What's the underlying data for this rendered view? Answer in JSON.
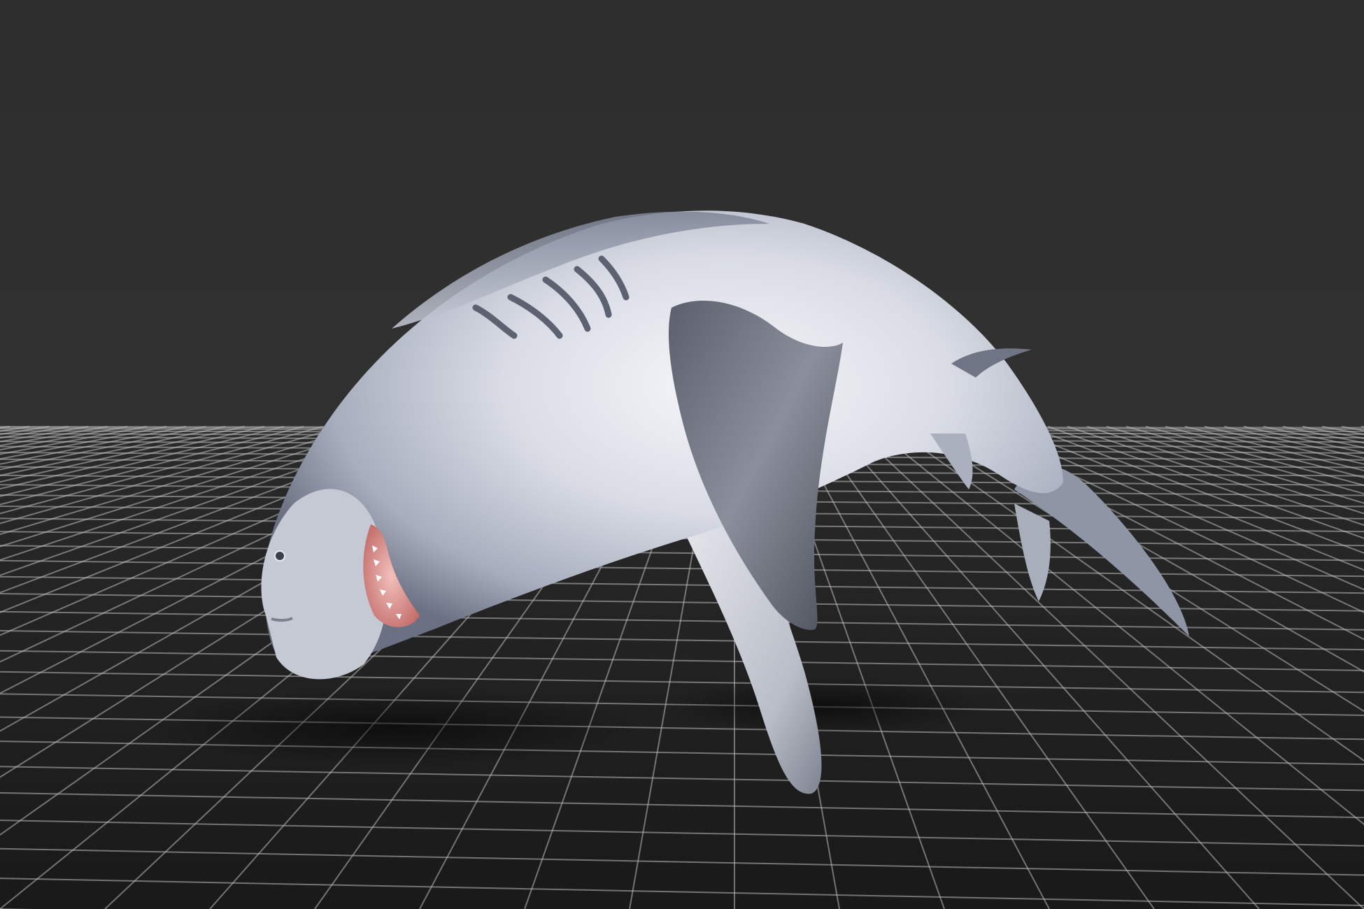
{
  "viewport": {
    "background_color": "#2f2f2f",
    "grid_visible": true,
    "grid_color": "#bdbdbd",
    "floor_color": "#1e1e1e"
  },
  "model": {
    "subject": "shark",
    "body_color": "#c8ccd8",
    "shadow_color": "#4a5060",
    "fin_color": "#6d727e",
    "mouth_color": "#e7a3a1"
  }
}
